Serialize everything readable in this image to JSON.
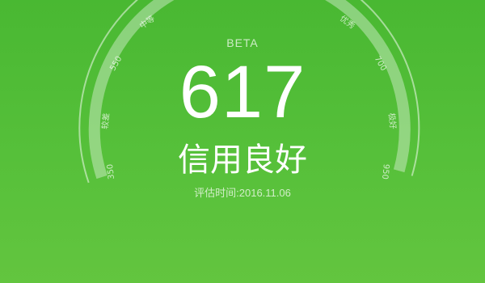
{
  "gauge": {
    "labels": [
      {
        "id": "gauge-label-350",
        "text": "350"
      },
      {
        "id": "gauge-label-poor",
        "text": "较差"
      },
      {
        "id": "gauge-label-550",
        "text": "550"
      },
      {
        "id": "gauge-label-medium",
        "text": "中等"
      },
      {
        "id": "gauge-label-excellent",
        "text": "优秀"
      },
      {
        "id": "gauge-label-700",
        "text": "700"
      },
      {
        "id": "gauge-label-very-good",
        "text": "极好"
      },
      {
        "id": "gauge-label-950",
        "text": "950"
      }
    ]
  },
  "badge": "BETA",
  "score": "617",
  "status": "信用良好",
  "eval_time": "评估时间:2016.11.06",
  "colors": {
    "background": "#4fbb36",
    "text": "#ffffff"
  }
}
